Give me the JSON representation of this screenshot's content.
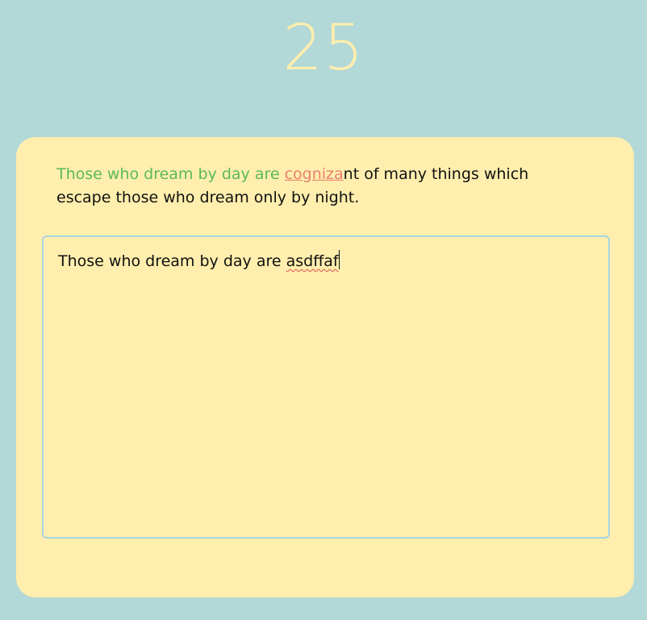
{
  "timer": {
    "seconds": "25"
  },
  "prompt": {
    "typed_correct": "Those who dream by day are ",
    "typed_error": "cognizа",
    "remaining": "nt of many things which escape those who dream only by night."
  },
  "input": {
    "value_prefix": "Those who dream by day are ",
    "misspelled_word": "asdffaf"
  },
  "colors": {
    "background": "#b2d8d8",
    "card": "#ffeead",
    "timer": "#ffeead",
    "correct": "#5cb85c",
    "error": "#e8806f",
    "input_border": "#a8d4e0",
    "text": "#111111"
  }
}
